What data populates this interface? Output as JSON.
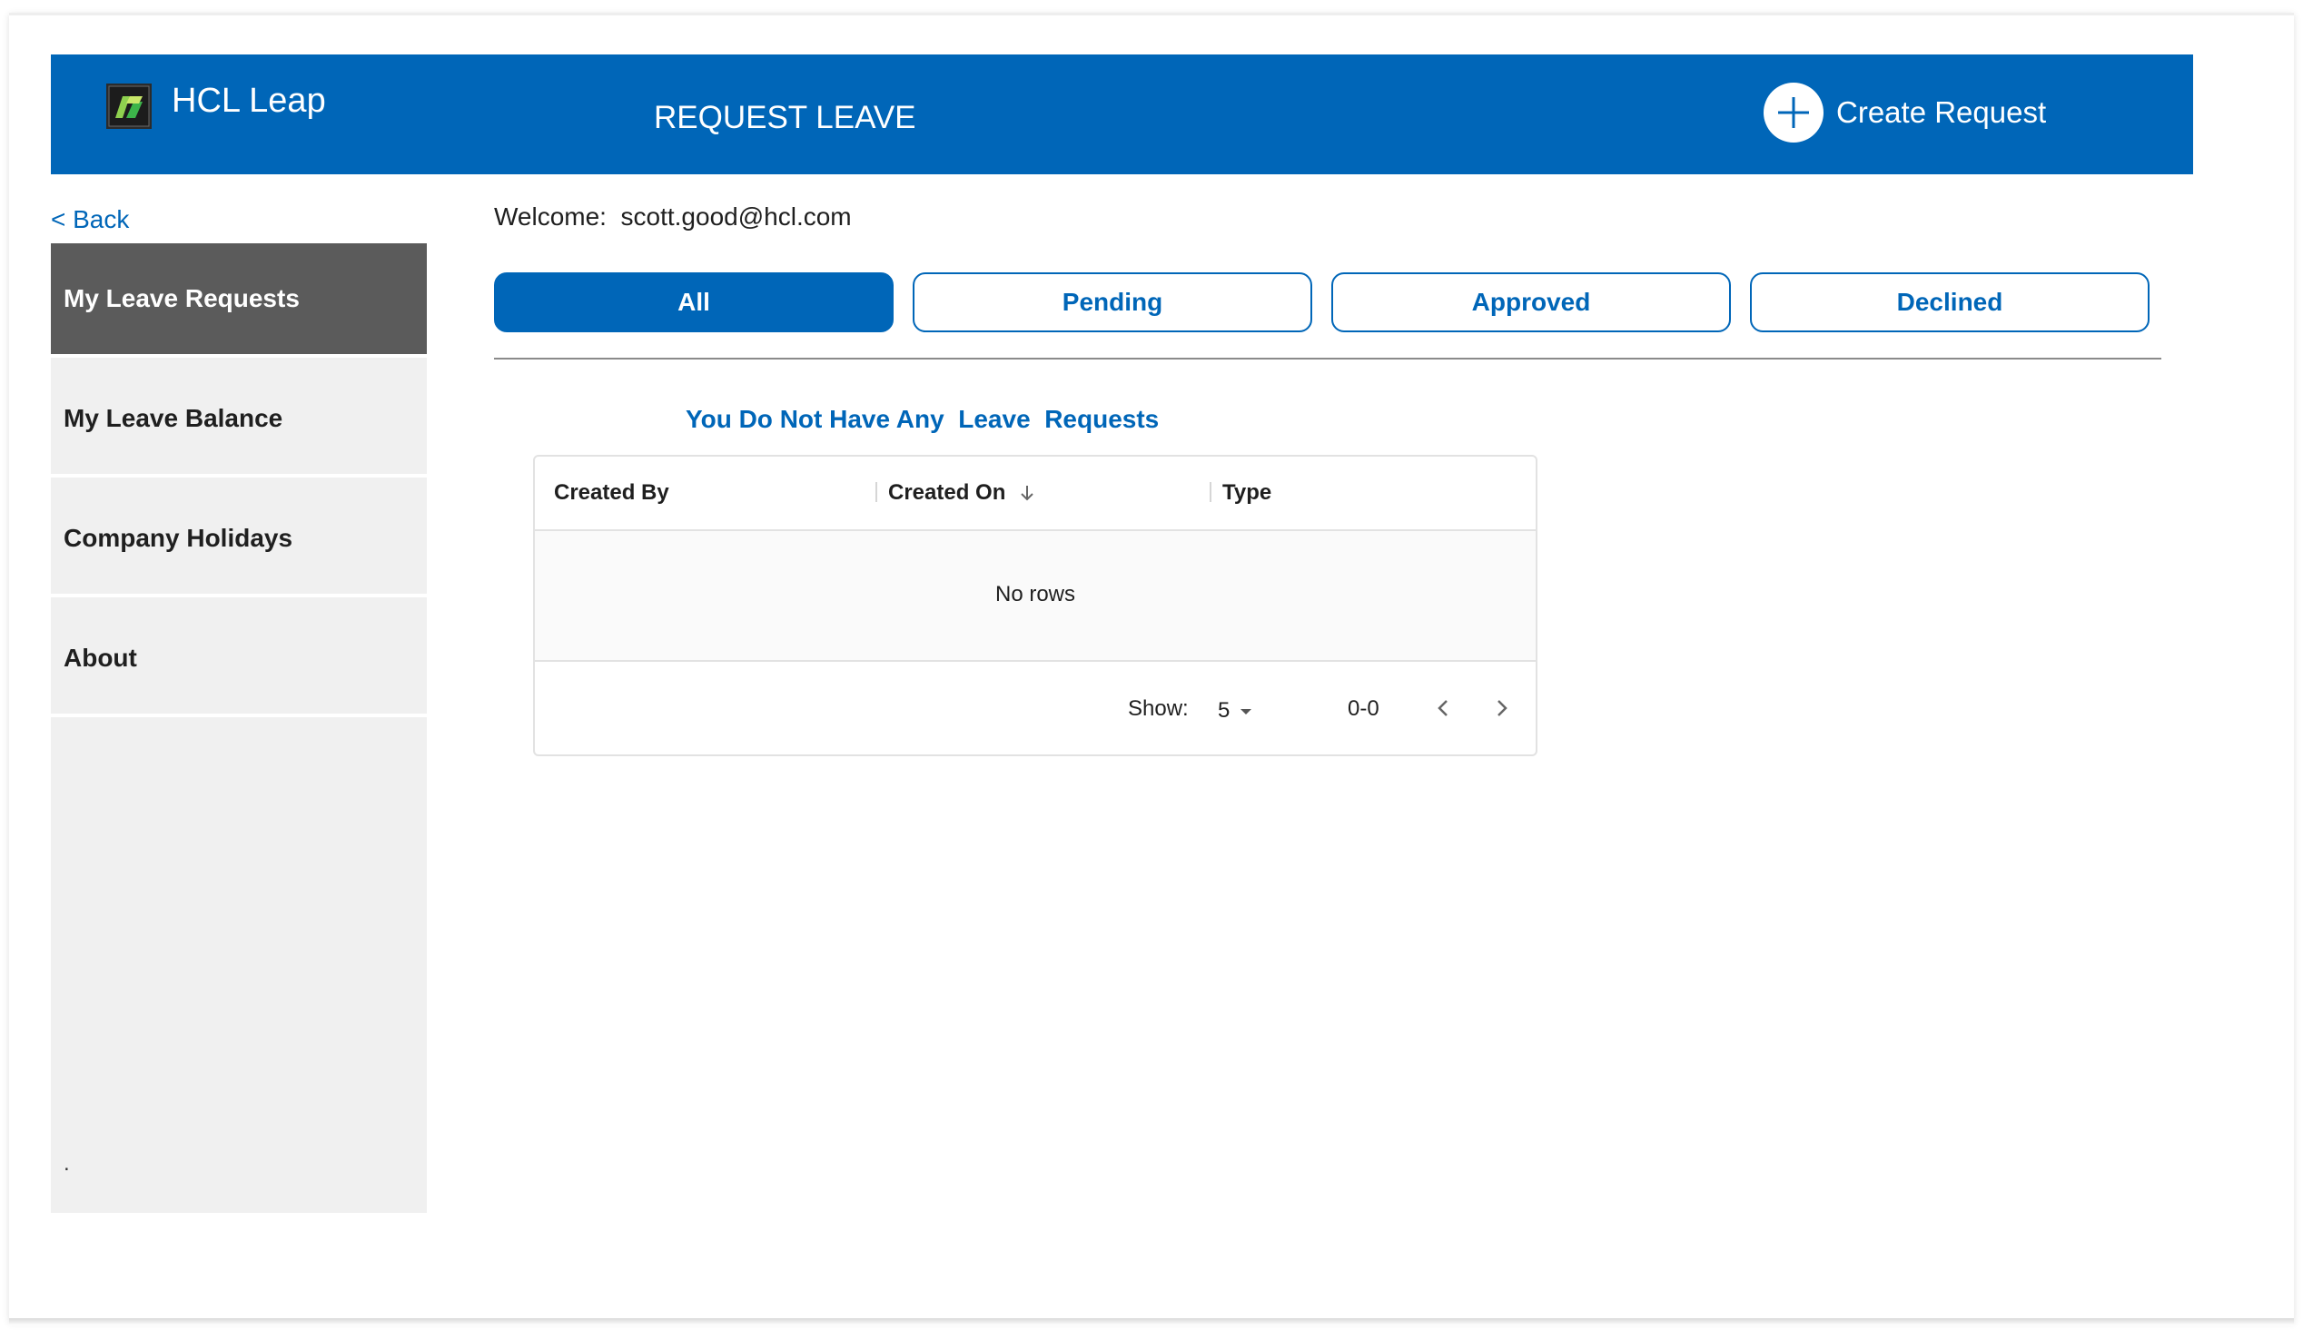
{
  "header": {
    "brand": "HCL Leap",
    "title": "REQUEST LEAVE",
    "create_label": "Create Request"
  },
  "nav": {
    "back_label": "< Back",
    "items": [
      {
        "label": "My Leave Requests",
        "active": true
      },
      {
        "label": "My Leave Balance",
        "active": false
      },
      {
        "label": "Company Holidays",
        "active": false
      },
      {
        "label": "About",
        "active": false
      }
    ],
    "footer_dot": "."
  },
  "main": {
    "welcome": "Welcome:  scott.good@hcl.com",
    "tabs": [
      {
        "label": "All",
        "active": true
      },
      {
        "label": "Pending",
        "active": false
      },
      {
        "label": "Approved",
        "active": false
      },
      {
        "label": "Declined",
        "active": false
      }
    ],
    "empty_message": "You Do Not Have Any  Leave  Requests",
    "grid": {
      "columns": [
        "Created By",
        "Created On",
        "Type"
      ],
      "sorted_column": "Created On",
      "sort_direction": "descending",
      "empty_text": "No rows",
      "show_label": "Show:",
      "page_size": "5",
      "range": "0-0"
    }
  },
  "colors": {
    "primary": "#0066b8",
    "sidebar_bg": "#f0f0f0",
    "sidebar_active": "#5b5b5b"
  }
}
